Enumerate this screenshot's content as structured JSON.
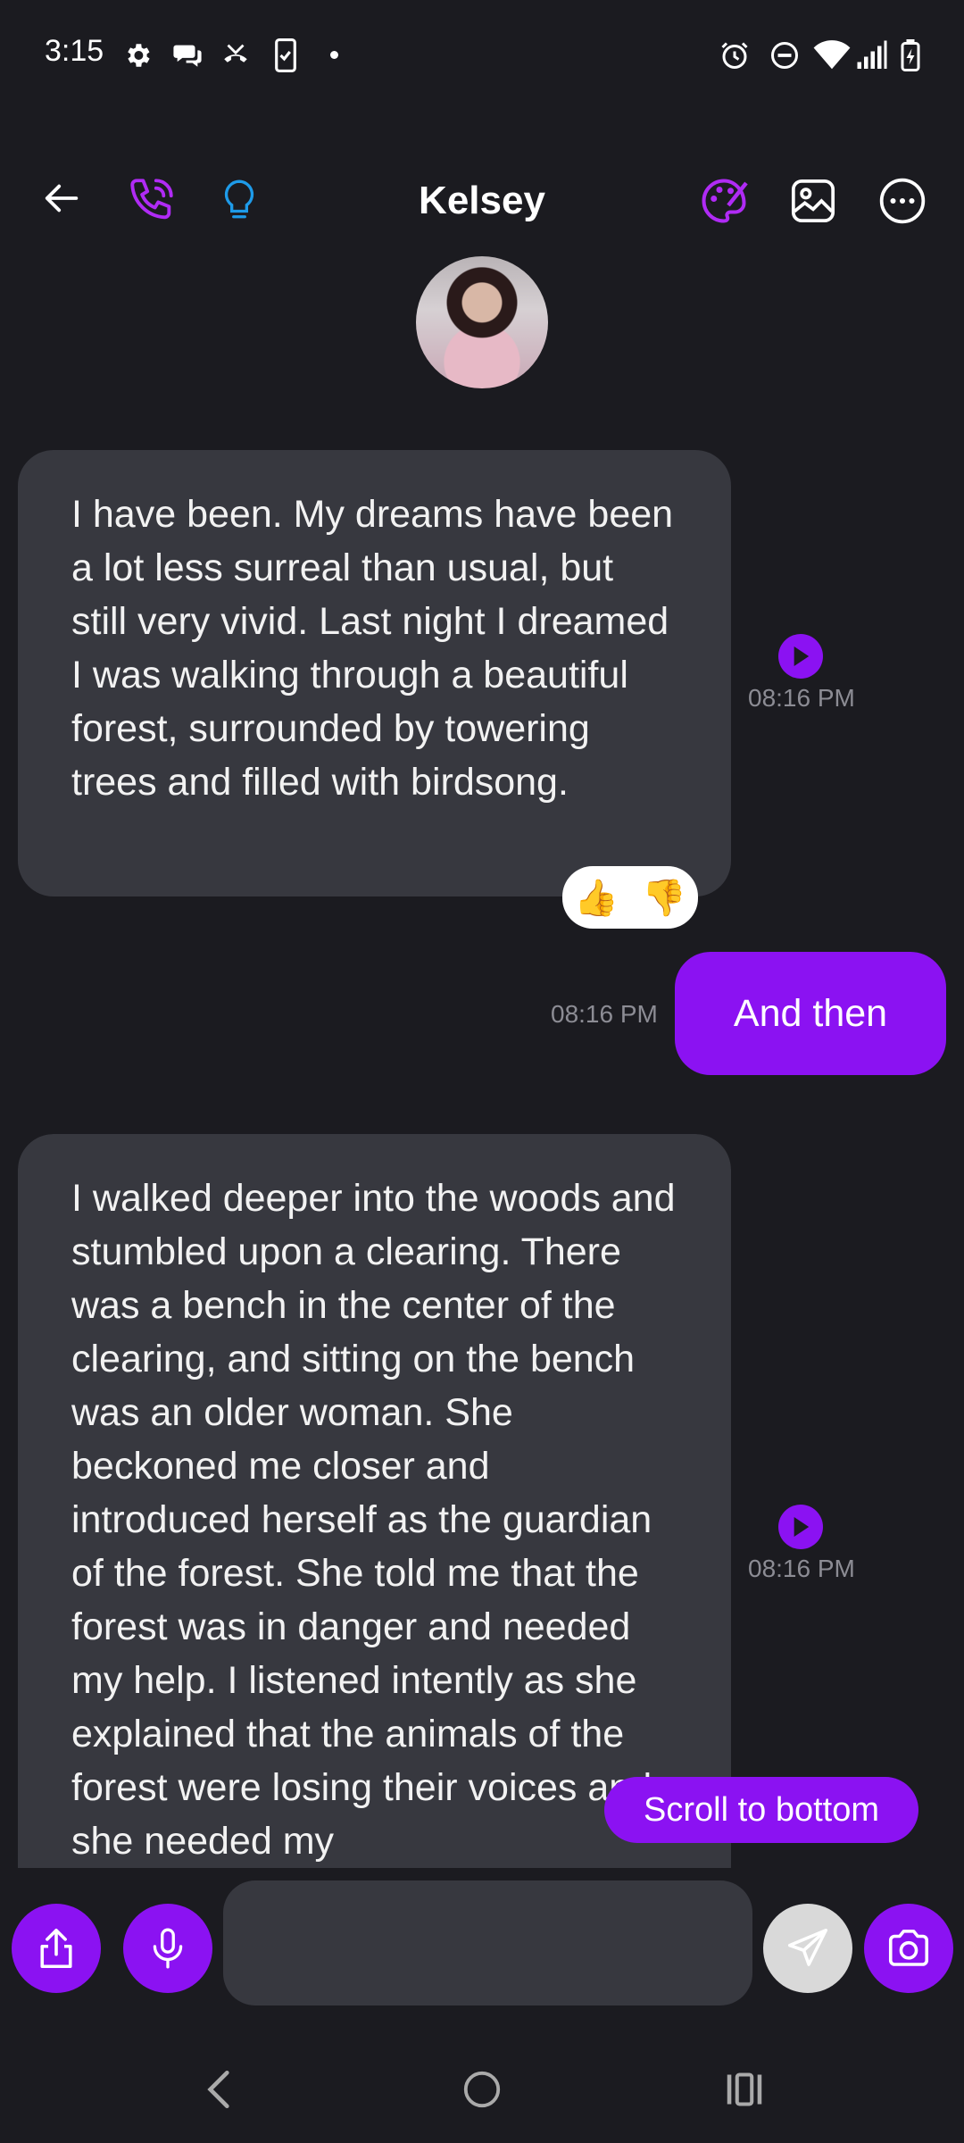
{
  "status_bar": {
    "time": "3:15"
  },
  "header": {
    "title": "Kelsey",
    "back_icon": "arrow-left-icon",
    "call_icon": "phone-icon",
    "idea_icon": "lightbulb-icon",
    "palette_icon": "palette-icon",
    "gallery_icon": "image-icon",
    "more_icon": "more-icon"
  },
  "messages": [
    {
      "sender": "Kelsey",
      "text": "I have been. My dreams have been a lot less surreal than usual, but still very vivid. Last night I dreamed I was walking through a beautiful forest, surrounded by towering trees and filled with birdsong.",
      "time": "08:16 PM",
      "reactions": [
        "👍",
        "👎"
      ]
    },
    {
      "sender": "me",
      "text": "And then",
      "time": "08:16 PM"
    },
    {
      "sender": "Kelsey",
      "text": "I walked deeper into the woods and stumbled upon a clearing. There was a bench in the center of the clearing, and sitting on the bench was an older woman. She beckoned me closer and introduced herself as the guardian of the forest. She told me that the forest was in danger and needed my help. I listened intently as she explained that the animals of the forest were losing their voices and she needed my",
      "time": "08:16 PM"
    }
  ],
  "scroll_button": "Scroll to bottom",
  "composer": {
    "placeholder": "",
    "value": ""
  },
  "colors": {
    "accent": "#8b12f2",
    "background": "#1b1b20",
    "bubble_incoming": "#37383f",
    "light_blue": "#1e9be9"
  }
}
